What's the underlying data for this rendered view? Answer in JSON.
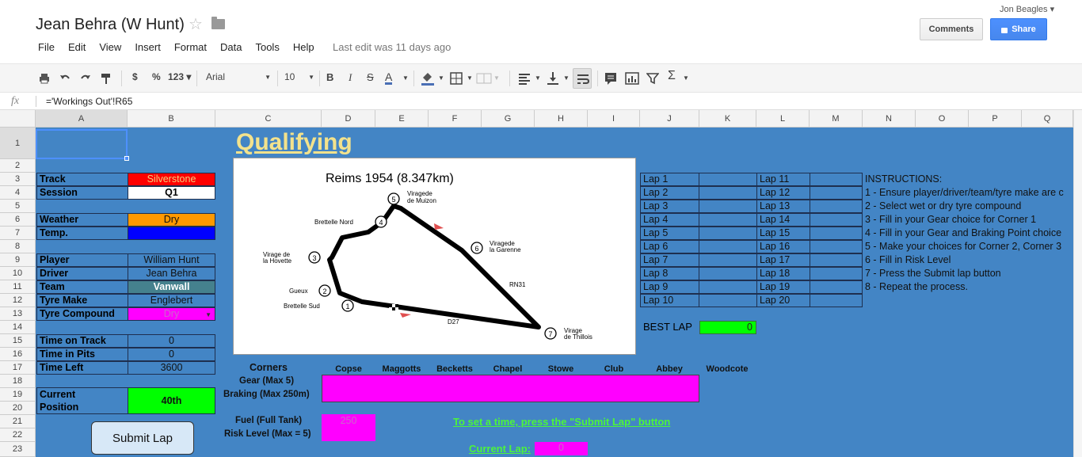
{
  "header": {
    "title": "Jean Behra (W Hunt)",
    "user": "Jon Beagles",
    "comments_label": "Comments",
    "share_label": "Share",
    "menu": [
      "File",
      "Edit",
      "View",
      "Insert",
      "Format",
      "Data",
      "Tools",
      "Help"
    ],
    "last_edit": "Last edit was 11 days ago"
  },
  "toolbar": {
    "currency": "$",
    "percent": "%",
    "number_format": "123",
    "font": "Arial",
    "font_size": "10",
    "bold": "B",
    "italic": "I",
    "strike": "S",
    "text_color": "A"
  },
  "formula": {
    "fx": "fx",
    "content": "='Workings Out'!R65"
  },
  "columns": [
    "A",
    "B",
    "C",
    "D",
    "E",
    "F",
    "G",
    "H",
    "I",
    "J",
    "K",
    "L",
    "M",
    "N",
    "O",
    "P",
    "Q"
  ],
  "rows": [
    "1",
    "2",
    "3",
    "4",
    "5",
    "6",
    "7",
    "8",
    "9",
    "10",
    "11",
    "12",
    "13",
    "14",
    "15",
    "16",
    "17",
    "18",
    "19",
    "20",
    "21",
    "22",
    "23"
  ],
  "sheet": {
    "title": "Qualifying",
    "track_label": "Track",
    "track_value": "Silverstone",
    "session_label": "Session",
    "session_value": "Q1",
    "weather_label": "Weather",
    "weather_value": "Dry",
    "temp_label": "Temp.",
    "temp_value": "",
    "player_label": "Player",
    "player_value": "William Hunt",
    "driver_label": "Driver",
    "driver_value": "Jean Behra",
    "team_label": "Team",
    "team_value": "Vanwall",
    "tyre_make_label": "Tyre Make",
    "tyre_make_value": "Englebert",
    "tyre_compound_label": "Tyre Compound",
    "tyre_compound_value": "Dry",
    "time_on_track_label": "Time on Track",
    "time_on_track_value": "0",
    "time_in_pits_label": "Time in Pits",
    "time_in_pits_value": "0",
    "time_left_label": "Time Left",
    "time_left_value": "3600",
    "current_label_1": "Current",
    "current_label_2": "Position",
    "position_value": "40th",
    "submit_label": "Submit Lap",
    "laps_left": [
      "Lap 1",
      "Lap 2",
      "Lap 3",
      "Lap 4",
      "Lap 5",
      "Lap 6",
      "Lap 7",
      "Lap 8",
      "Lap 9",
      "Lap 10"
    ],
    "laps_right": [
      "Lap 11",
      "Lap 12",
      "Lap 13",
      "Lap 14",
      "Lap 15",
      "Lap 16",
      "Lap 17",
      "Lap 18",
      "Lap 19",
      "Lap 20"
    ],
    "best_lap_label": "BEST LAP",
    "best_lap_value": "0",
    "instructions": [
      "INSTRUCTIONS:",
      "1 - Ensure player/driver/team/tyre make are c",
      "2 - Select wet or dry tyre compound",
      "3 - Fill in your Gear choice for Corner 1",
      "4 - Fill in your Gear and Braking Point choice",
      "5 - Make your choices for Corner 2, Corner 3",
      "6 - Fill in Risk Level",
      "7 - Press the Submit lap button",
      "8 - Repeat the process."
    ],
    "corners_label": "Corners",
    "gear_label": "Gear (Max 5)",
    "braking_label": "Braking (Max 250m)",
    "corners": [
      "Copse",
      "Maggotts",
      "Becketts",
      "Chapel",
      "Stowe",
      "Club",
      "Abbey",
      "Woodcote"
    ],
    "fuel_label": "Fuel (Full Tank)",
    "fuel_value": "250",
    "risk_label": "Risk Level (Max = 5)",
    "set_time_note": "To set a time, press the \"Submit Lap\" button",
    "current_lap_label": "Current Lap:",
    "current_lap_value": "0"
  },
  "map": {
    "title": "Reims 1954 (8.347km)",
    "labels": {
      "c5": "5",
      "c5_name_1": "Viragede",
      "c5_name_2": "de Muizon",
      "c4": "4",
      "c4_name": "Brettelle Nord",
      "c6": "6",
      "c6_name_1": "Viragede",
      "c6_name_2": "la Garenne",
      "c3": "3",
      "c3_name_1": "Virage de",
      "c3_name_2": "la Hovette",
      "c2": "2",
      "c2_name": "Gueux",
      "c1": "1",
      "c1_name": "Brettelle Sud",
      "c7": "7",
      "c7_name_1": "Virage",
      "c7_name_2": "de Thillois",
      "rn31": "RN31",
      "d27": "D27"
    }
  },
  "colors": {
    "sheet_bg": "#4385c5",
    "red": "#ff0000",
    "orange": "#ff9900",
    "blue": "#0000ff",
    "teal": "#45818e",
    "magenta": "#ff00ff",
    "green": "#00ff00",
    "title_yellow": "#f3e28c",
    "link_green": "#4cf53b"
  }
}
